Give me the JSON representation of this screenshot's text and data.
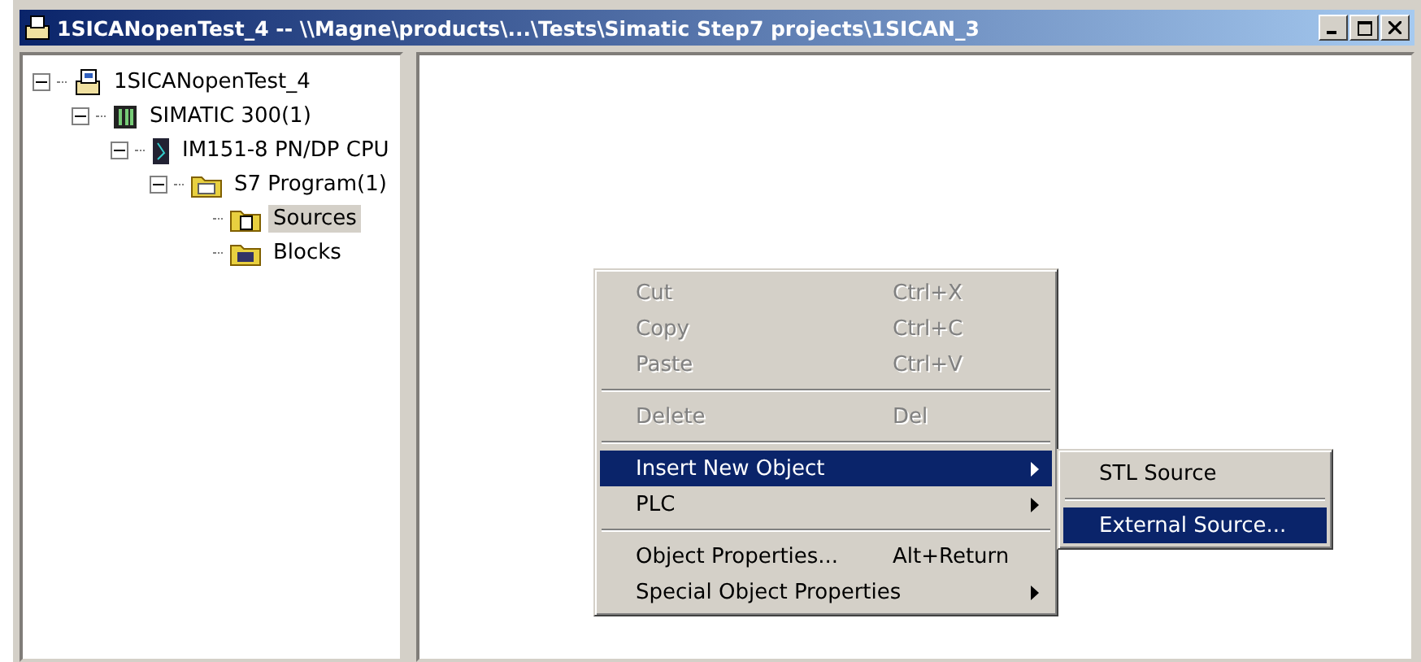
{
  "window": {
    "title": "1SICANopenTest_4 -- \\\\Magne\\products\\...\\Tests\\Simatic Step7 projects\\1SICAN_3"
  },
  "tree": [
    {
      "label": "1SICANopenTest_4",
      "kind": "project",
      "expanded": true,
      "selected": false,
      "children": [
        {
          "label": "SIMATIC 300(1)",
          "kind": "station",
          "expanded": true,
          "selected": false,
          "children": [
            {
              "label": "IM151-8 PN/DP CPU",
              "kind": "cpu",
              "expanded": true,
              "selected": false,
              "children": [
                {
                  "label": "S7 Program(1)",
                  "kind": "program",
                  "expanded": true,
                  "selected": false,
                  "children": [
                    {
                      "label": "Sources",
                      "kind": "sources",
                      "selected": true
                    },
                    {
                      "label": "Blocks",
                      "kind": "blocks",
                      "selected": false
                    }
                  ]
                }
              ]
            }
          ]
        }
      ]
    }
  ],
  "context_menu": [
    {
      "kind": "item",
      "label": "Cut",
      "shortcut": "Ctrl+X",
      "disabled": true,
      "selected": false
    },
    {
      "kind": "item",
      "label": "Copy",
      "shortcut": "Ctrl+C",
      "disabled": true,
      "selected": false
    },
    {
      "kind": "item",
      "label": "Paste",
      "shortcut": "Ctrl+V",
      "disabled": true,
      "selected": false
    },
    {
      "kind": "separator"
    },
    {
      "kind": "item",
      "label": "Delete",
      "shortcut": "Del",
      "disabled": true,
      "selected": false
    },
    {
      "kind": "separator"
    },
    {
      "kind": "submenu",
      "label": "Insert New Object",
      "disabled": false,
      "selected": true
    },
    {
      "kind": "submenu",
      "label": "PLC",
      "disabled": false,
      "selected": false
    },
    {
      "kind": "separator"
    },
    {
      "kind": "item",
      "label": "Object Properties...",
      "shortcut": "Alt+Return",
      "disabled": false,
      "selected": false
    },
    {
      "kind": "submenu",
      "label": "Special Object Properties",
      "disabled": false,
      "selected": false
    }
  ],
  "submenu": [
    {
      "kind": "item",
      "label": "STL Source",
      "disabled": false,
      "selected": false
    },
    {
      "kind": "separator"
    },
    {
      "kind": "item",
      "label": "External Source...",
      "disabled": false,
      "selected": true
    }
  ]
}
